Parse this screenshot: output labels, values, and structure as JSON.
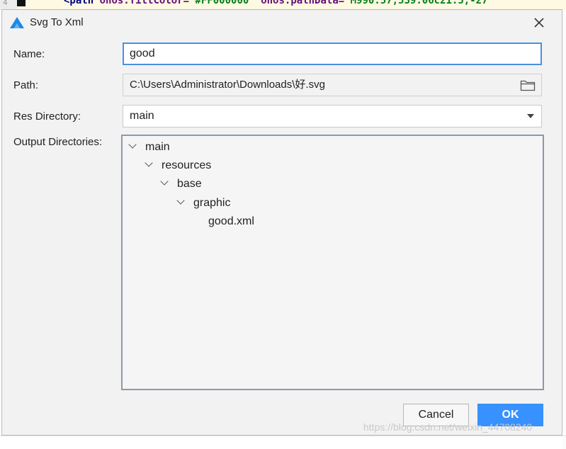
{
  "editor": {
    "line_number": "4",
    "code_tag": "<path",
    "code_attr1": "ohos:fillColor=",
    "code_val1": "\"#FF000000\"",
    "code_attr2": "ohos:pathData=",
    "code_val2": "\"M990.57,539.06c21.5,-27"
  },
  "dialog": {
    "title": "Svg To Xml",
    "close_label": "✕"
  },
  "form": {
    "name_label": "Name:",
    "name_value": "good",
    "path_label": "Path:",
    "path_value": "C:\\Users\\Administrator\\Downloads\\好.svg",
    "res_dir_label": "Res Directory:",
    "res_dir_value": "main",
    "output_dirs_label": "Output Directories:"
  },
  "tree": [
    {
      "label": "main",
      "expanded": true
    },
    {
      "label": "resources",
      "expanded": true
    },
    {
      "label": "base",
      "expanded": true
    },
    {
      "label": "graphic",
      "expanded": true
    },
    {
      "label": "good.xml",
      "expanded": false
    }
  ],
  "buttons": {
    "cancel_label": "Cancel",
    "ok_label": "OK"
  },
  "watermark": "https://blog.csdn.net/weixin_44708240",
  "icons": {
    "app": "harmony-logo-icon",
    "folder": "folder-icon",
    "close": "close-icon",
    "dropdown": "dropdown-arrow-icon",
    "tree_expanded": "chevron-down-icon"
  },
  "colors": {
    "accent": "#3791ff",
    "focus_border": "#4a90e2",
    "dialog_bg": "#f2f2f2"
  }
}
